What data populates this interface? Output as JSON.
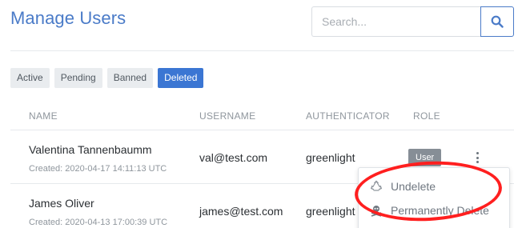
{
  "header": {
    "title": "Manage Users"
  },
  "search": {
    "placeholder": "Search...",
    "value": "",
    "icon": "search-icon"
  },
  "filters": [
    {
      "label": "Active",
      "selected": false
    },
    {
      "label": "Pending",
      "selected": false
    },
    {
      "label": "Banned",
      "selected": false
    },
    {
      "label": "Deleted",
      "selected": true
    }
  ],
  "table": {
    "columns": [
      "NAME",
      "USERNAME",
      "AUTHENTICATOR",
      "ROLE"
    ],
    "rows": [
      {
        "name": "Valentina Tannenbaumm",
        "created": "Created: 2020-04-17 14:11:13 UTC",
        "username": "val@test.com",
        "authenticator": "greenlight",
        "role": "User"
      },
      {
        "name": "James Oliver",
        "created": "Created: 2020-04-13 17:00:39 UTC",
        "username": "james@test.com",
        "authenticator": "greenlight",
        "role": ""
      }
    ]
  },
  "dropdown": {
    "items": [
      {
        "label": "Undelete",
        "icon": "recycle-icon"
      },
      {
        "label": "Permanently Delete",
        "icon": "skull-crossbones-icon"
      }
    ]
  },
  "colors": {
    "accent": "#4a7bc8",
    "active_filter": "#3b76d3",
    "annotation": "#ff1f1f"
  }
}
